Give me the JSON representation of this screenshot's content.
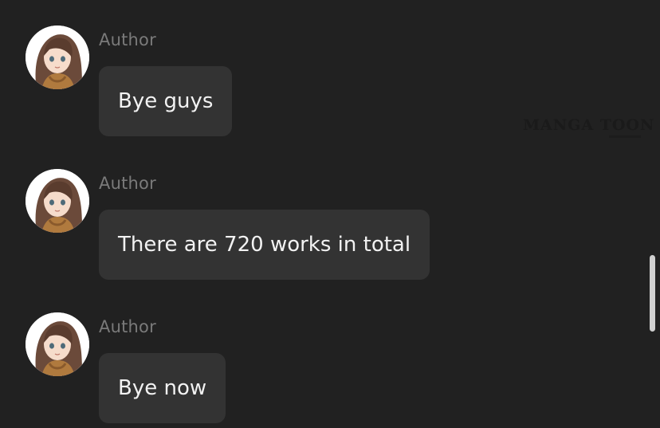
{
  "messages": [
    {
      "author": "Author",
      "text": "Bye guys"
    },
    {
      "author": "Author",
      "text": "There are 720 works in total"
    },
    {
      "author": "Author",
      "text": "Bye now"
    }
  ],
  "watermark": {
    "text": "MANGA TOON"
  },
  "colors": {
    "background": "#212121",
    "bubble": "#333333",
    "author_text": "#7a7a7a",
    "message_text": "#f2f2f2",
    "scrollbar": "#d0d0d0"
  }
}
